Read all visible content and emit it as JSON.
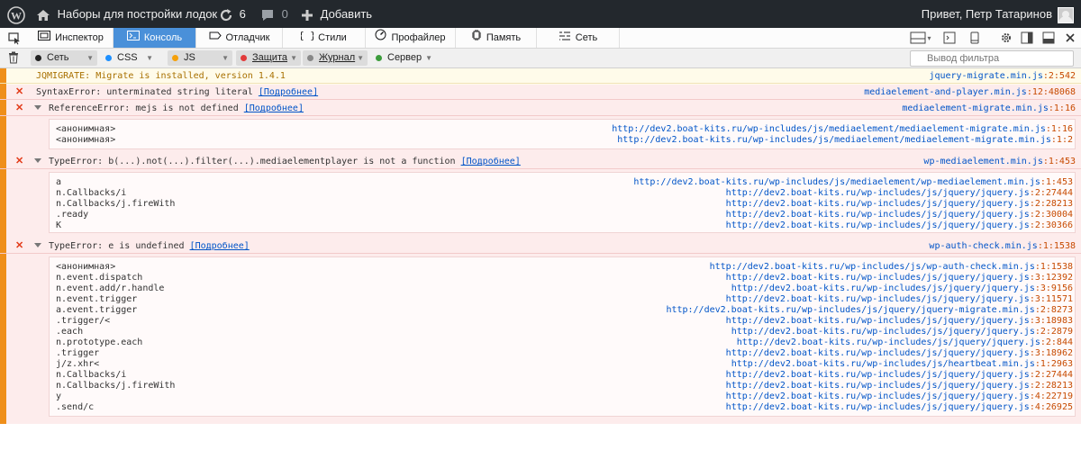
{
  "adminbar": {
    "site_name": "Наборы для постройки лодок",
    "updates_count": "6",
    "comments_count": "0",
    "new_label": "Добавить",
    "greeting": "Привет, Петр Татаринов"
  },
  "devtools": {
    "tabs": [
      {
        "label": "Инспектор",
        "icon": "inspector-icon",
        "selected": false
      },
      {
        "label": "Консоль",
        "icon": "console-icon",
        "selected": true
      },
      {
        "label": "Отладчик",
        "icon": "debugger-icon",
        "selected": false
      },
      {
        "label": "Стили",
        "icon": "styles-icon",
        "selected": false
      },
      {
        "label": "Профайлер",
        "icon": "profiler-icon",
        "selected": false
      },
      {
        "label": "Память",
        "icon": "memory-icon",
        "selected": false
      },
      {
        "label": "Сеть",
        "icon": "network-icon",
        "selected": false
      }
    ],
    "filters": [
      {
        "label": "Сеть",
        "color": "#222222"
      },
      {
        "label": "CSS",
        "color": "#1e90ff"
      },
      {
        "label": "JS",
        "color": "#f5a00a"
      },
      {
        "label": "Защита",
        "color": "#e23b3b"
      },
      {
        "label": "Журнал",
        "color": "#888888"
      },
      {
        "label": "Сервер",
        "color": "#3c9c3c"
      }
    ],
    "filter_placeholder": "Вывод фильтра"
  },
  "console": {
    "more_label": "[Подробнее]",
    "messages": [
      {
        "type": "warn",
        "text": "JQMIGRATE: Migrate is installed, version 1.4.1",
        "file": "jquery-migrate.min.js",
        "pos": ":2:542"
      },
      {
        "type": "error",
        "text": "SyntaxError: unterminated string literal",
        "file": "mediaelement-and-player.min.js",
        "pos": ":12:48068"
      },
      {
        "type": "error",
        "text": "ReferenceError: mejs is not defined",
        "file": "mediaelement-migrate.min.js",
        "pos": ":1:16",
        "frames": [
          {
            "fn": "<анонимная>",
            "url": "http://dev2.boat-kits.ru/wp-includes/js/mediaelement/mediaelement-migrate.min.js",
            "pos": ":1:16"
          },
          {
            "fn": "<анонимная>",
            "url": "http://dev2.boat-kits.ru/wp-includes/js/mediaelement/mediaelement-migrate.min.js",
            "pos": ":1:2"
          }
        ]
      },
      {
        "type": "error",
        "text": "TypeError: b(...).not(...).filter(...).mediaelementplayer is not a function",
        "file": "wp-mediaelement.min.js",
        "pos": ":1:453",
        "frames": [
          {
            "fn": "a",
            "url": "http://dev2.boat-kits.ru/wp-includes/js/mediaelement/wp-mediaelement.min.js",
            "pos": ":1:453"
          },
          {
            "fn": "n.Callbacks/i",
            "url": "http://dev2.boat-kits.ru/wp-includes/js/jquery/jquery.js",
            "pos": ":2:27444"
          },
          {
            "fn": "n.Callbacks/j.fireWith",
            "url": "http://dev2.boat-kits.ru/wp-includes/js/jquery/jquery.js",
            "pos": ":2:28213"
          },
          {
            "fn": ".ready",
            "url": "http://dev2.boat-kits.ru/wp-includes/js/jquery/jquery.js",
            "pos": ":2:30004"
          },
          {
            "fn": "K",
            "url": "http://dev2.boat-kits.ru/wp-includes/js/jquery/jquery.js",
            "pos": ":2:30366"
          }
        ]
      },
      {
        "type": "error",
        "text": "TypeError: e is undefined",
        "file": "wp-auth-check.min.js",
        "pos": ":1:1538",
        "frames": [
          {
            "fn": "<анонимная>",
            "url": "http://dev2.boat-kits.ru/wp-includes/js/wp-auth-check.min.js",
            "pos": ":1:1538"
          },
          {
            "fn": "n.event.dispatch",
            "url": "http://dev2.boat-kits.ru/wp-includes/js/jquery/jquery.js",
            "pos": ":3:12392"
          },
          {
            "fn": "n.event.add/r.handle",
            "url": "http://dev2.boat-kits.ru/wp-includes/js/jquery/jquery.js",
            "pos": ":3:9156"
          },
          {
            "fn": "n.event.trigger",
            "url": "http://dev2.boat-kits.ru/wp-includes/js/jquery/jquery.js",
            "pos": ":3:11571"
          },
          {
            "fn": "a.event.trigger",
            "url": "http://dev2.boat-kits.ru/wp-includes/js/jquery/jquery-migrate.min.js",
            "pos": ":2:8273"
          },
          {
            "fn": ".trigger/<",
            "url": "http://dev2.boat-kits.ru/wp-includes/js/jquery/jquery.js",
            "pos": ":3:18983"
          },
          {
            "fn": ".each",
            "url": "http://dev2.boat-kits.ru/wp-includes/js/jquery/jquery.js",
            "pos": ":2:2879"
          },
          {
            "fn": "n.prototype.each",
            "url": "http://dev2.boat-kits.ru/wp-includes/js/jquery/jquery.js",
            "pos": ":2:844"
          },
          {
            "fn": ".trigger",
            "url": "http://dev2.boat-kits.ru/wp-includes/js/jquery/jquery.js",
            "pos": ":3:18962"
          },
          {
            "fn": "j/z.xhr<",
            "url": "http://dev2.boat-kits.ru/wp-includes/js/heartbeat.min.js",
            "pos": ":1:2963"
          },
          {
            "fn": "n.Callbacks/i",
            "url": "http://dev2.boat-kits.ru/wp-includes/js/jquery/jquery.js",
            "pos": ":2:27444"
          },
          {
            "fn": "n.Callbacks/j.fireWith",
            "url": "http://dev2.boat-kits.ru/wp-includes/js/jquery/jquery.js",
            "pos": ":2:28213"
          },
          {
            "fn": "y",
            "url": "http://dev2.boat-kits.ru/wp-includes/js/jquery/jquery.js",
            "pos": ":4:22719"
          },
          {
            "fn": ".send/c",
            "url": "http://dev2.boat-kits.ru/wp-includes/js/jquery/jquery.js",
            "pos": ":4:26925"
          }
        ]
      }
    ]
  }
}
